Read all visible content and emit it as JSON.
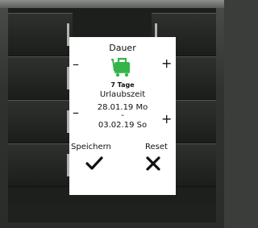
{
  "screen": {
    "title": "Dauer",
    "duration_value": "7 Tage",
    "subtitle": "Urlaubszeit",
    "date_start": "28.01.19 Mo",
    "date_separator": "-",
    "date_end": "03.02.19 So",
    "save_label": "Speichern",
    "reset_label": "Reset",
    "minus_symbol": "–",
    "plus_symbol": "+"
  },
  "colors": {
    "accent": "#35b44a",
    "text": "#111111",
    "screen_bg": "#ffffff"
  },
  "icons": {
    "duration": "suitcase-icon",
    "save": "check-icon",
    "reset": "cross-icon"
  }
}
